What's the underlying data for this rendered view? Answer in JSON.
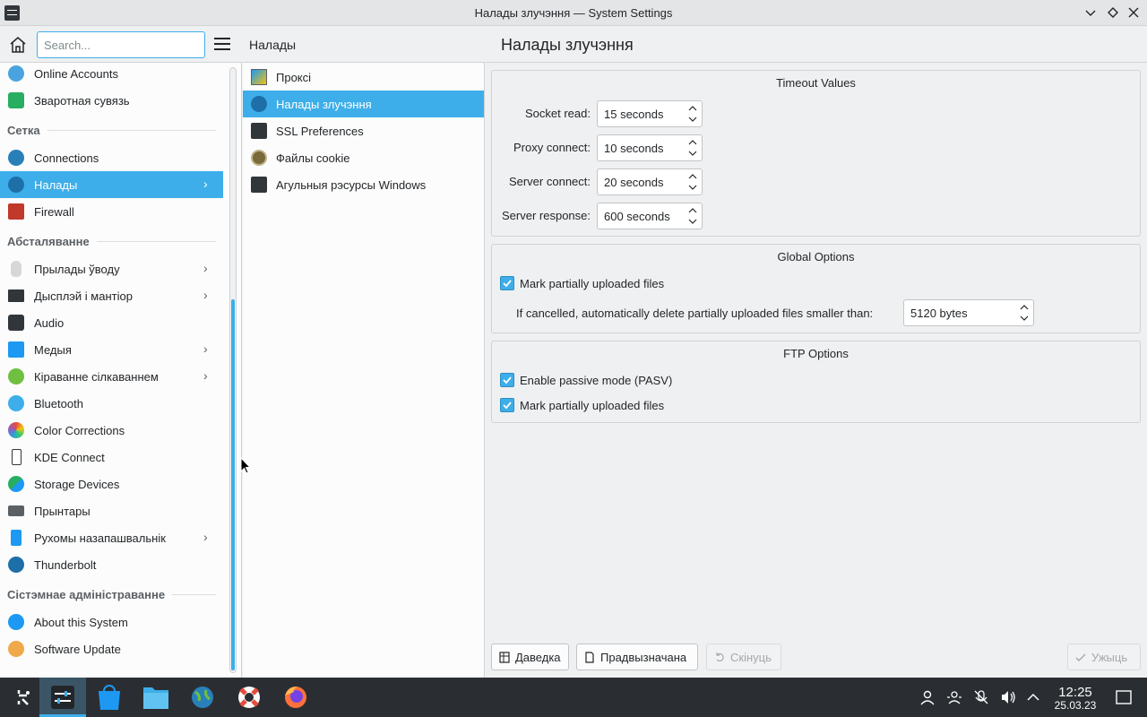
{
  "window": {
    "title": "Налады злучэння — System Settings"
  },
  "sidebar": {
    "search_placeholder": "Search...",
    "items": [
      {
        "label": "Online Accounts"
      },
      {
        "label": "Зваротная сувязь"
      },
      {
        "label": "Connections"
      },
      {
        "label": "Налады"
      },
      {
        "label": "Firewall"
      },
      {
        "label": "Прылады ўводу"
      },
      {
        "label": "Дысплэй і мантіор"
      },
      {
        "label": "Audio"
      },
      {
        "label": "Медыя"
      },
      {
        "label": "Кіраванне сілкаваннем"
      },
      {
        "label": "Bluetooth"
      },
      {
        "label": "Color Corrections"
      },
      {
        "label": "KDE Connect"
      },
      {
        "label": "Storage Devices"
      },
      {
        "label": "Прынтары"
      },
      {
        "label": "Рухомы назапашвальнік"
      },
      {
        "label": "Thunderbolt"
      },
      {
        "label": "About this System"
      },
      {
        "label": "Software Update"
      }
    ],
    "sections": {
      "network": "Сетка",
      "hardware": "Абсталяванне",
      "sysadmin": "Сістэмнае адміністраванне"
    }
  },
  "middle": {
    "title": "Налады",
    "items": [
      {
        "label": "Проксі"
      },
      {
        "label": "Налады злучэння"
      },
      {
        "label": "SSL Preferences"
      },
      {
        "label": "Файлы cookie"
      },
      {
        "label": "Агульныя рэсурсы Windows"
      }
    ]
  },
  "main": {
    "title": "Налады злучэння",
    "timeout": {
      "title": "Timeout Values",
      "socket_read_label": "Socket read:",
      "socket_read_value": "15 seconds",
      "proxy_connect_label": "Proxy connect:",
      "proxy_connect_value": "10 seconds",
      "server_connect_label": "Server connect:",
      "server_connect_value": "20 seconds",
      "server_response_label": "Server response:",
      "server_response_value": "600 seconds"
    },
    "global": {
      "title": "Global Options",
      "mark_partial_label": "Mark partially uploaded files",
      "mark_partial_checked": true,
      "delete_label": "If cancelled, automatically delete partially uploaded files smaller than:",
      "delete_value": "5120 bytes"
    },
    "ftp": {
      "title": "FTP Options",
      "passive_label": "Enable passive mode (PASV)",
      "passive_checked": true,
      "mark_partial_label": "Mark partially uploaded files",
      "mark_partial_checked": true
    },
    "buttons": {
      "help": "Даведка",
      "defaults": "Прадвызначана",
      "reset": "Скінуць",
      "apply": "Ужыць"
    }
  },
  "taskbar": {
    "time": "12:25",
    "date": "25.03.23"
  },
  "colors": {
    "accent": "#3daee9",
    "panel": "#2a2e32"
  }
}
